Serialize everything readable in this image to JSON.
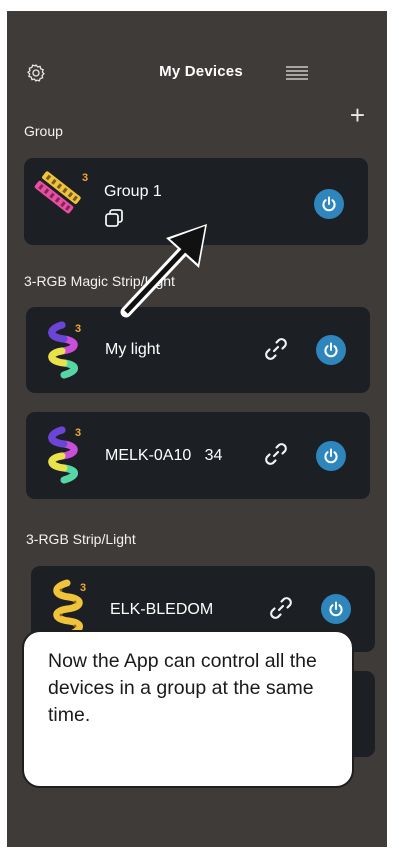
{
  "header": {
    "title": "My Devices",
    "settings_icon": "gear-icon",
    "menu_icon": "menu-icon"
  },
  "group_section": {
    "label": "Group",
    "add_icon": "plus-icon",
    "card": {
      "name": "Group 1",
      "badge": "3",
      "copy_icon": "copy-icon",
      "power_icon": "power-icon"
    }
  },
  "magic_section": {
    "label": "3-RGB Magic Strip/Light",
    "devices": [
      {
        "name": "My light",
        "badge": "3"
      },
      {
        "name": "MELK-0A10   34",
        "badge": "3"
      }
    ]
  },
  "strip_section": {
    "label": "3-RGB Strip/Light",
    "devices": [
      {
        "name": "ELK-BLEDOM",
        "badge": "3"
      }
    ]
  },
  "tooltip": {
    "text": "Now the App can control all the devices in a group at the same time."
  },
  "colors": {
    "background": "#3f3b38",
    "card": "#1c1f24",
    "power": "#2f86bd",
    "badge": "#f2a531"
  }
}
